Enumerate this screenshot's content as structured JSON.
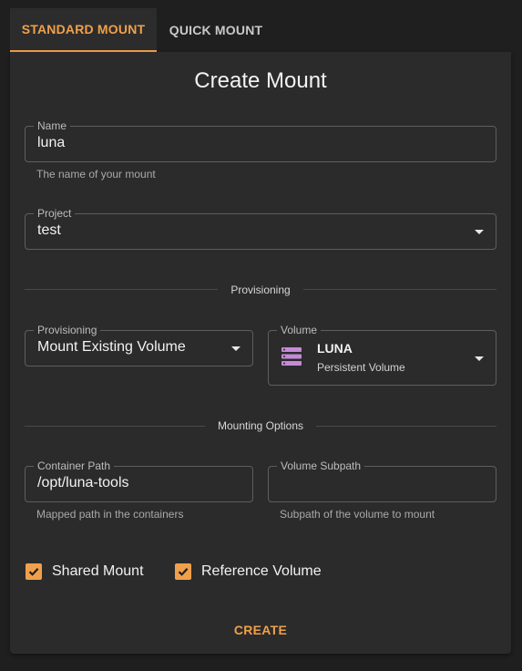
{
  "tabs": {
    "standard": "STANDARD MOUNT",
    "quick": "QUICK MOUNT"
  },
  "form": {
    "title": "Create Mount",
    "name": {
      "label": "Name",
      "value": "luna",
      "helper": "The name of your mount"
    },
    "project": {
      "label": "Project",
      "value": "test"
    },
    "provisioning_divider": "Provisioning",
    "provisioning": {
      "label": "Provisioning",
      "value": "Mount Existing Volume"
    },
    "volume": {
      "label": "Volume",
      "name": "LUNA",
      "type": "Persistent Volume",
      "icon": "storage-icon"
    },
    "mounting_divider": "Mounting Options",
    "container_path": {
      "label": "Container Path",
      "value": "/opt/luna-tools",
      "helper": "Mapped path in the containers"
    },
    "volume_subpath": {
      "label": "Volume Subpath",
      "value": "",
      "helper": "Subpath of the volume to mount"
    },
    "shared_mount": {
      "label": "Shared Mount",
      "checked": true
    },
    "reference_volume": {
      "label": "Reference Volume",
      "checked": true
    },
    "create_label": "CREATE"
  },
  "colors": {
    "accent": "#f0a04b",
    "background": "#1f1f1f",
    "card": "#2b2b2b",
    "volume_icon": "#c58ad8"
  }
}
